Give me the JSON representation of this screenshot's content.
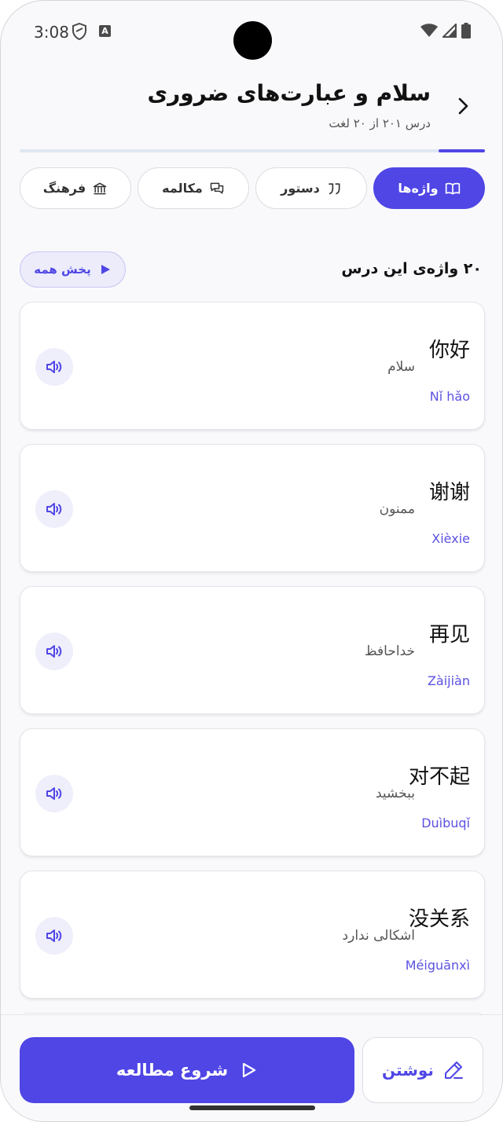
{
  "status_bar": {
    "time": "3:08",
    "a_badge": "A"
  },
  "header": {
    "title": "سلام و عبارت‌های ضروری",
    "subtitle": "درس ۲۰۱ از ۲۰ لغت",
    "progress": 0.1
  },
  "tabs": [
    {
      "label": "واژه‌ها",
      "icon": "book-icon",
      "active": true
    },
    {
      "label": "دستور",
      "icon": "quote-icon",
      "active": false
    },
    {
      "label": "مکالمه",
      "icon": "chat-icon",
      "active": false
    },
    {
      "label": "فرهنگ",
      "icon": "museum-icon",
      "active": false
    }
  ],
  "section": {
    "title": "۲۰ واژه‌ی این درس",
    "play_all_label": "پخش همه"
  },
  "words": [
    {
      "hanzi": "你好",
      "translation": "سلام",
      "pinyin": "Nǐ hǎo"
    },
    {
      "hanzi": "谢谢",
      "translation": "ممنون",
      "pinyin": "Xièxie"
    },
    {
      "hanzi": "再见",
      "translation": "خداحافظ",
      "pinyin": "Zàijiàn"
    },
    {
      "hanzi": "对不起",
      "translation": "ببخشید",
      "pinyin": "Duìbuqǐ"
    },
    {
      "hanzi": "没关系",
      "translation": "اشکالی ندارد",
      "pinyin": "Méiguānxì"
    }
  ],
  "bottom": {
    "start_label": "شروع مطالعه",
    "write_label": "نوشتن"
  },
  "colors": {
    "accent": "#4f46e5",
    "accent_soft": "#efeefb"
  }
}
